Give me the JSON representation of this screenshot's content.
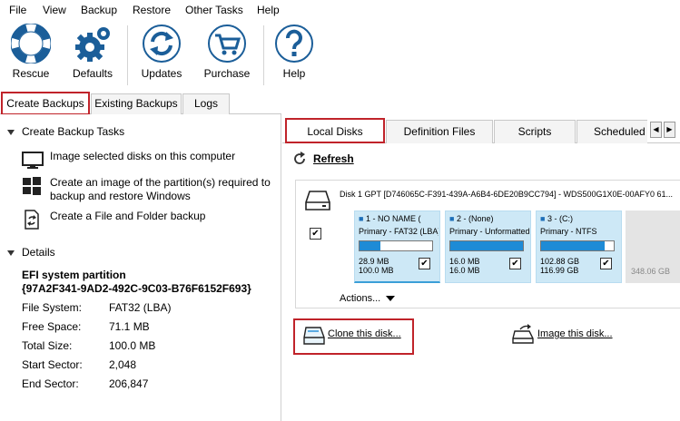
{
  "menu": [
    "File",
    "View",
    "Backup",
    "Restore",
    "Other Tasks",
    "Help"
  ],
  "toolbar": {
    "rescue": "Rescue",
    "defaults": "Defaults",
    "updates": "Updates",
    "purchase": "Purchase",
    "help": "Help"
  },
  "left_tabs": [
    "Create Backups",
    "Existing Backups",
    "Logs"
  ],
  "tasks": {
    "heading": "Create Backup Tasks",
    "items": [
      "Image selected disks on this computer",
      "Create an image of the partition(s) required to backup and restore Windows",
      "Create a File and Folder backup"
    ]
  },
  "details": {
    "heading": "Details",
    "title": "EFI system partition",
    "guid": "{97A2F341-9AD2-492C-9C03-B76F6152F693}",
    "rows": [
      {
        "k": "File System:",
        "v": "FAT32 (LBA)"
      },
      {
        "k": "Free Space:",
        "v": "71.1 MB"
      },
      {
        "k": "Total Size:",
        "v": "100.0 MB"
      },
      {
        "k": "Start Sector:",
        "v": "2,048"
      },
      {
        "k": "End Sector:",
        "v": "206,847"
      }
    ]
  },
  "right_tabs": [
    "Local Disks",
    "Definition Files",
    "Scripts",
    "Scheduled"
  ],
  "refresh": "Refresh",
  "disk": {
    "title": "Disk 1 GPT [D746065C-F391-439A-A6B4-6DE20B9CC794] - WDS500G1X0E-00AFY0 61...",
    "partitions": [
      {
        "head": "1 - NO NAME (",
        "type": "Primary - FAT32 (LBA)",
        "fill": 0.29,
        "used": "28.9 MB",
        "total": "100.0 MB"
      },
      {
        "head": "2 -  (None)",
        "type": "Primary - Unformatted",
        "fill": 1.0,
        "used": "16.0 MB",
        "total": "16.0 MB"
      },
      {
        "head": "3 -  (C:)",
        "type": "Primary - NTFS",
        "fill": 0.88,
        "used": "102.88 GB",
        "total": "116.99 GB"
      }
    ],
    "unallocated": "348.06 GB",
    "actions": "Actions..."
  },
  "clone": "Clone this disk...",
  "image": "Image this disk...",
  "colors": {
    "highlight": "#c0232a",
    "partition": "#cde8f6",
    "bar": "#1e8bd6"
  }
}
